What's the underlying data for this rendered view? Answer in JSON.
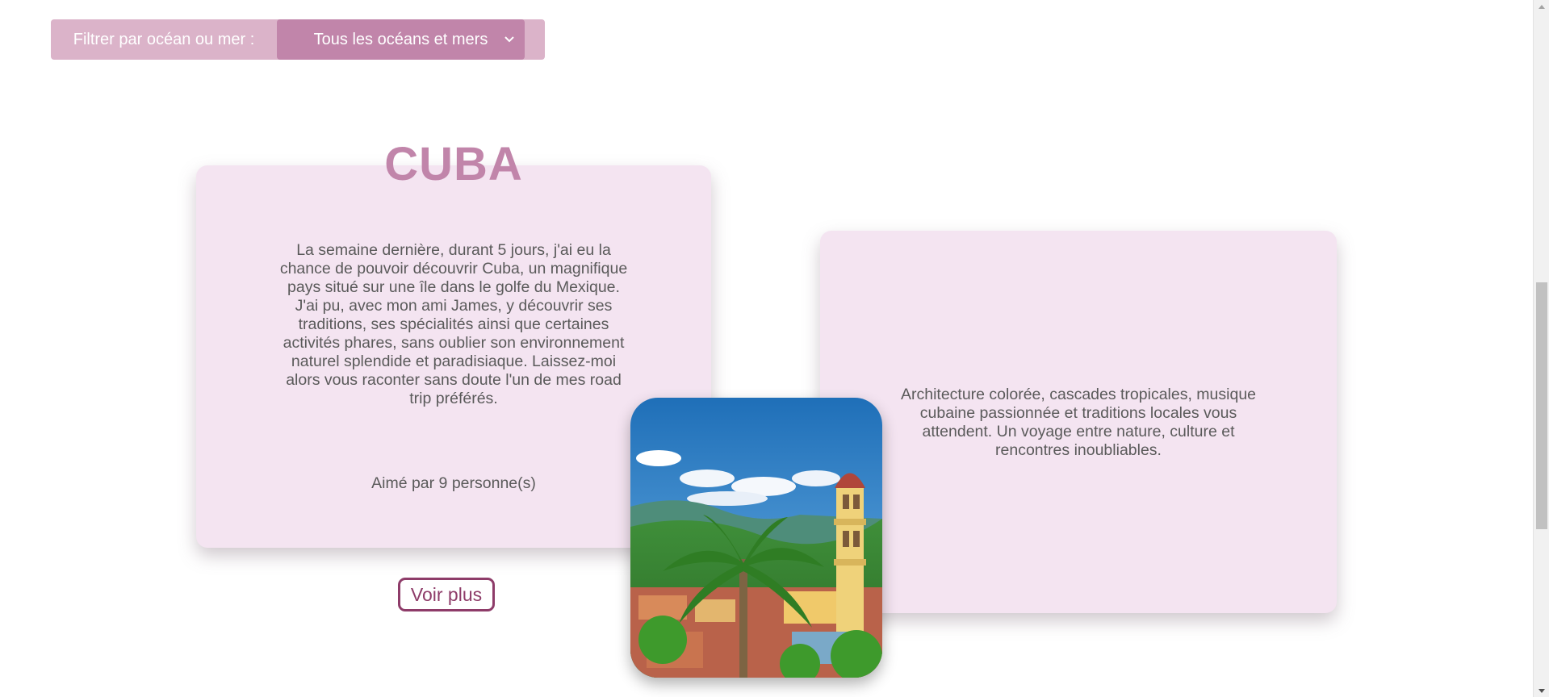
{
  "filter": {
    "label": "Filtrer par océan ou mer :",
    "selected": "Tous les océans et mers"
  },
  "article": {
    "title": "CUBA",
    "description": "La semaine dernière, durant 5 jours, j'ai eu la chance de pouvoir découvrir Cuba, un magnifique pays situé sur une île dans le golfe du Mexique. J'ai pu, avec mon ami James, y découvrir ses traditions, ses spécialités ainsi que certaines activités phares, sans oublier son environnement naturel splendide et paradisiaque. Laissez-moi alors vous raconter sans doute l'un de mes road trip préférés.",
    "likes": "Aimé par 9 personne(s)",
    "more_button": "Voir plus",
    "side_text": "Architecture colorée, cascades tropicales, musique cubaine passionnée et traditions locales vous attendent. Un voyage entre nature, culture et rencontres inoubliables."
  },
  "colors": {
    "accent": "#c185aa",
    "accent_light": "#dbb3c9",
    "card_bg": "#f4e4f1",
    "button_border": "#8e3c69"
  },
  "icons": {
    "select": "chevron-down-icon",
    "scroll_up": "triangle-up-icon",
    "scroll_down": "triangle-down-icon"
  }
}
